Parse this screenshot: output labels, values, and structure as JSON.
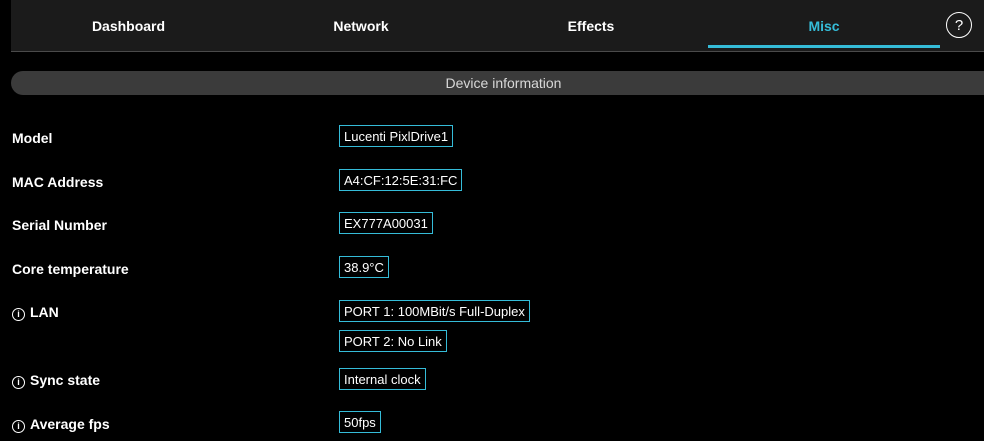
{
  "tabs": [
    {
      "label": "Dashboard",
      "active": false
    },
    {
      "label": "Network",
      "active": false
    },
    {
      "label": "Effects",
      "active": false
    },
    {
      "label": "Misc",
      "active": true
    }
  ],
  "help_label": "?",
  "section_title": "Device information",
  "rows": {
    "model": {
      "label": "Model",
      "value": "Lucenti PixlDrive1"
    },
    "mac": {
      "label": "MAC Address",
      "value": "A4:CF:12:5E:31:FC"
    },
    "serial": {
      "label": "Serial Number",
      "value": "EX777A00031"
    },
    "temp": {
      "label": "Core temperature",
      "value": "38.9°C"
    },
    "lan": {
      "label": "LAN",
      "port1": "PORT 1: 100MBit/s Full-Duplex",
      "port2": "PORT 2: No Link"
    },
    "sync": {
      "label": "Sync state",
      "value": "Internal clock"
    },
    "fps": {
      "label": "Average fps",
      "value": "50fps"
    }
  },
  "info_icon_glyph": "i",
  "colors": {
    "accent": "#35bcd8",
    "background": "#000000",
    "navbar": "#1b1b1b",
    "section_bar": "#3b3b3b"
  }
}
